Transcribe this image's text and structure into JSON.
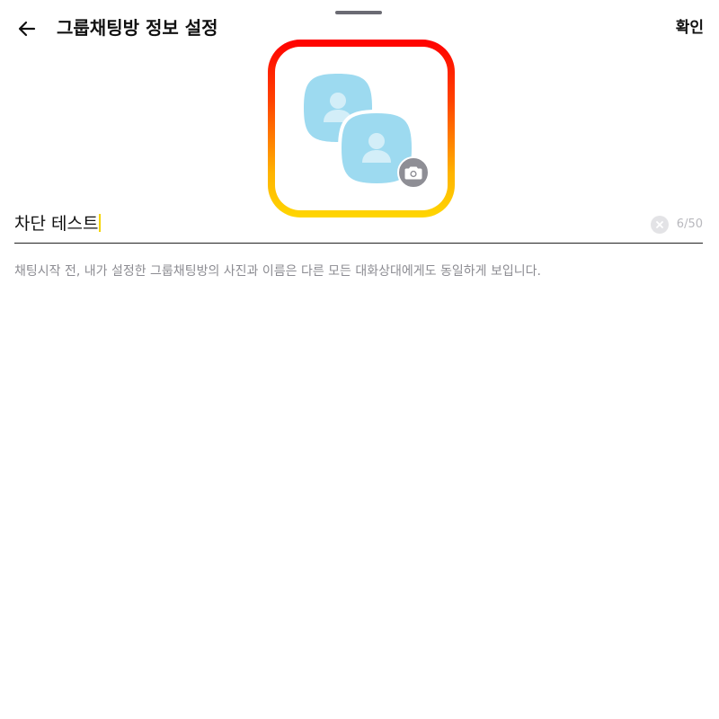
{
  "header": {
    "title": "그룹채팅방 정보 설정",
    "confirm_label": "확인",
    "back_icon": "arrow-left-icon"
  },
  "profile": {
    "icons": [
      "group-profile-icon",
      "camera-icon"
    ],
    "frame_gradient": [
      "#ff0000",
      "#ffd600"
    ],
    "avatar_color": "#9ddaf0",
    "badge_color": "#8e8e95"
  },
  "name_field": {
    "value": "차단 테스트",
    "counter": "6/50",
    "clear_icon": "clear-circle-icon"
  },
  "helper": {
    "text": "채팅시작 전, 내가 설정한 그룹채팅방의 사진과 이름은 다른 모든 대화상대에게도 동일하게 보입니다."
  }
}
